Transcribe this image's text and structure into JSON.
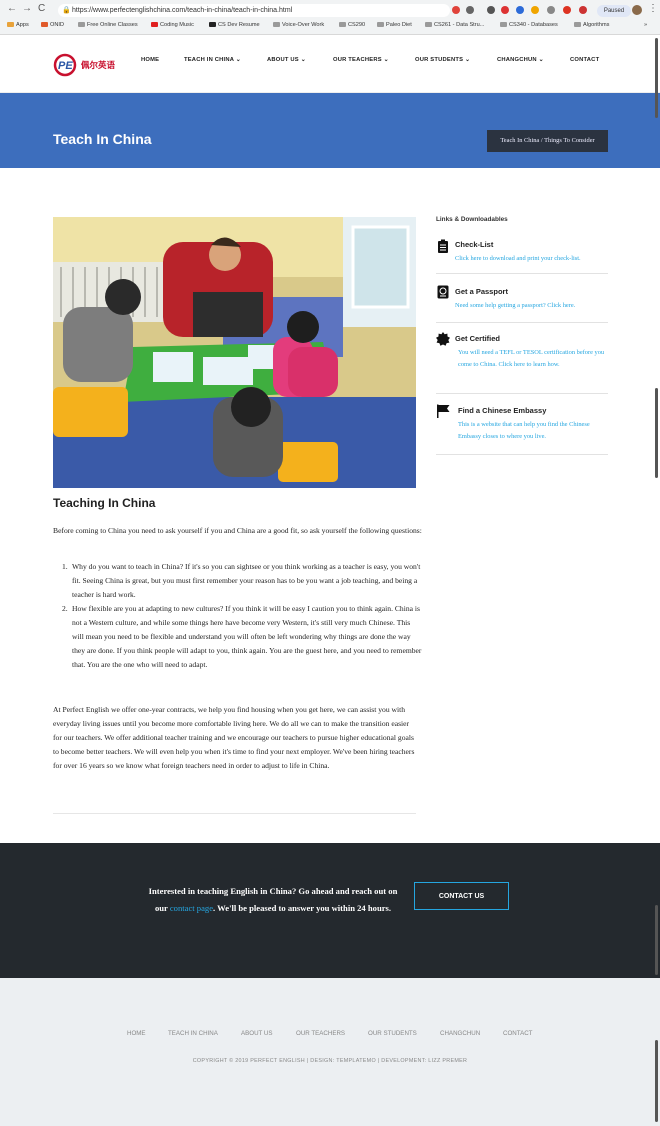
{
  "browser": {
    "url": "https://www.perfectenglishchina.com/teach-in-china/teach-in-china.html",
    "profile_status": "Paused",
    "bookmarks": [
      "Apps",
      "ONID",
      "Free Online Classes",
      "Coding Music",
      "CS Dev Resume",
      "Voice-Over Work",
      "CS290",
      "Paleo Diet",
      "CS261 - Data Stru...",
      "CS340 - Databases",
      "Algorithms"
    ],
    "overflow": "»"
  },
  "header": {
    "logo_text": "佩尔英语",
    "menu": [
      "HOME",
      "TEACH IN CHINA",
      "ABOUT US",
      "OUR TEACHERS",
      "OUR STUDENTS",
      "CHANGCHUN",
      "CONTACT"
    ],
    "dropdown_marker": "⌄"
  },
  "banner": {
    "title": "Teach In China",
    "breadcrumb": "Teach In China / Things To Consider"
  },
  "sidebar": {
    "heading": "Links & Downloadables",
    "items": [
      {
        "title": "Check-List",
        "link": "Click here to download and print your check-list.",
        "icon": "clipboard-icon"
      },
      {
        "title": "Get a Passport",
        "link": "Need some help getting a passport? Click here.",
        "icon": "passport-icon"
      },
      {
        "title": "Get Certified",
        "link": "You will need a TEFL or TESOL certification before you come to China. Click here to learn how.",
        "icon": "certificate-icon"
      },
      {
        "title": "Find a Chinese Embassy",
        "link": "This is a website that can help you find the Chinese Embassy closes to where you live.",
        "icon": "flag-icon"
      }
    ]
  },
  "main": {
    "heading": "Teaching In China",
    "intro": "Before coming to China you need to ask yourself if you and China are a good fit, so ask yourself the following questions:",
    "questions": [
      {
        "num": "1.",
        "text": "Why do you want to teach in China? If it's so you can sightsee or you think working as a teacher is easy, you won't fit. Seeing China is great, but you must first remember your reason has to be you want a job teaching, and being a teacher is hard work."
      },
      {
        "num": "2.",
        "text": "How flexible are you at adapting to new cultures? If you think it will be easy I caution you to think again. China is not a Western culture, and while some things here have become very Western, it's still very much Chinese. This will mean you need to be flexible and understand you will often be left wondering why things are done the way they are done. If you think people will adapt to you, think again. You are the guest here, and you need to remember that. You are the one who will need to adapt."
      }
    ],
    "paragraph": "At Perfect English we offer one-year contracts, we help you find housing when you get here, we can assist you with everyday living issues until you become more comfortable living here. We do all we can to make the transition easier for our teachers. We offer additional teacher training and we encourage our teachers to pursue higher educational goals to become better teachers. We will even help you when it's time to find your next employer. We've been hiring teachers for over 16 years so we know what foreign teachers need in order to adjust to life in China."
  },
  "cta": {
    "text_before": "Interested in teaching English in China? Go ahead and reach out on our ",
    "link": "contact page",
    "text_after": ". We'll be pleased to answer you within 24 hours.",
    "button": "CONTACT US"
  },
  "footer": {
    "menu": [
      "HOME",
      "TEACH IN CHINA",
      "ABOUT US",
      "OUR TEACHERS",
      "OUR STUDENTS",
      "CHANGCHUN",
      "CONTACT"
    ],
    "copyright": "COPYRIGHT © 2019 PERFECT ENGLISH | DESIGN: TEMPLATEMO | DEVELOPMENT: LIZZ PREMER"
  },
  "colors": {
    "banner": "#3d6ebd",
    "link": "#25a6e0",
    "cta_bg": "#24292e",
    "footer_bg": "#eceff2",
    "brand_red": "#c8102e"
  }
}
